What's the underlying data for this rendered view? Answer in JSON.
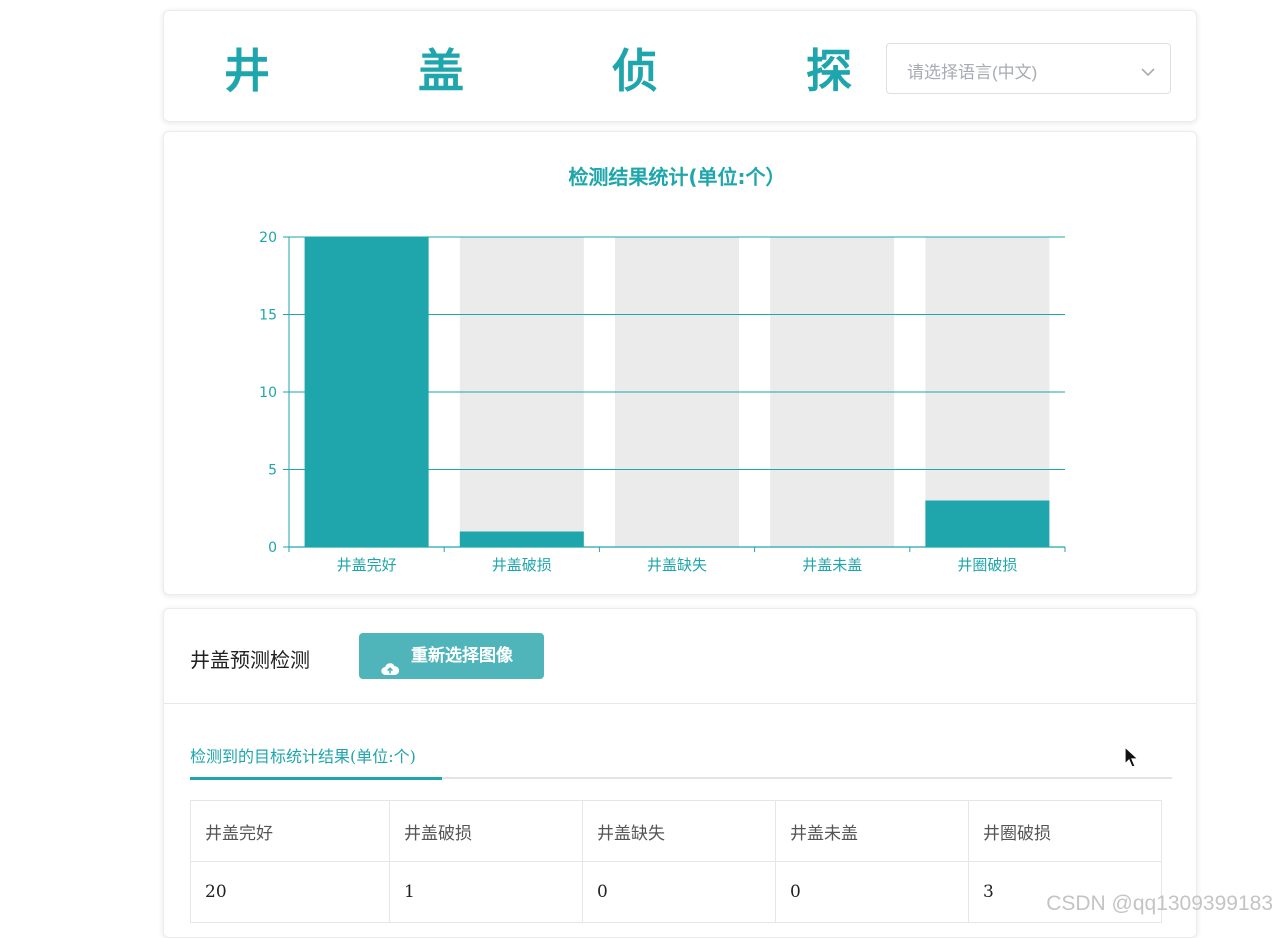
{
  "header": {
    "title": "井 盖 侦 探",
    "language_placeholder": "请选择语言(中文)",
    "colors": {
      "accent": "#1fa6ac"
    }
  },
  "chart_data": {
    "type": "bar",
    "title": "检测结果统计(单位:个）",
    "categories": [
      "井盖完好",
      "井盖破损",
      "井盖缺失",
      "井盖未盖",
      "井圈破损"
    ],
    "values": [
      20,
      1,
      0,
      0,
      3
    ],
    "yticks": [
      0,
      5,
      10,
      15,
      20
    ],
    "ylim": [
      0,
      20
    ],
    "grid": true,
    "background_bars": true,
    "colors": {
      "bar": "#1fa6ac",
      "background_bar": "#ebebeb",
      "axis": "#1fa6ac"
    }
  },
  "detect": {
    "title": "井盖预测检测",
    "reselect_button": "重新选择图像",
    "tab_label": "检测到的目标统计结果(单位:个)",
    "table": {
      "headers": [
        "井盖完好",
        "井盖破损",
        "井盖缺失",
        "井盖未盖",
        "井圈破损"
      ],
      "values": [
        "20",
        "1",
        "0",
        "0",
        "3"
      ]
    }
  },
  "watermark": "CSDN @qq1309399183"
}
